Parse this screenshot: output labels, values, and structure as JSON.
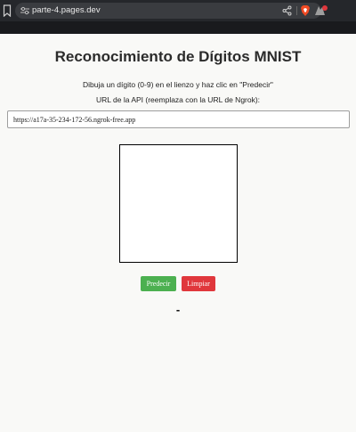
{
  "browser": {
    "url": "parte-4.pages.dev",
    "icons": [
      "bookmark-icon",
      "site-settings-icon",
      "share-icon",
      "brave-shield-icon",
      "brave-rewards-icon"
    ]
  },
  "page": {
    "title": "Reconocimiento de Dígitos MNIST",
    "instruction": "Dibuja un dígito (0-9) en el lienzo y haz clic en \"Predecir\"",
    "api_label": "URL de la API (reemplaza con la URL de Ngrok):",
    "api_url": "https://a17a-35-234-172-56.ngrok-free.app",
    "predict_label": "Predecir",
    "clear_label": "Limpiar",
    "result": "-"
  },
  "colors": {
    "background": "#f9f9f7",
    "predict_button": "#4cb050",
    "clear_button": "#e0373c",
    "browser_chrome": "#25272b"
  }
}
